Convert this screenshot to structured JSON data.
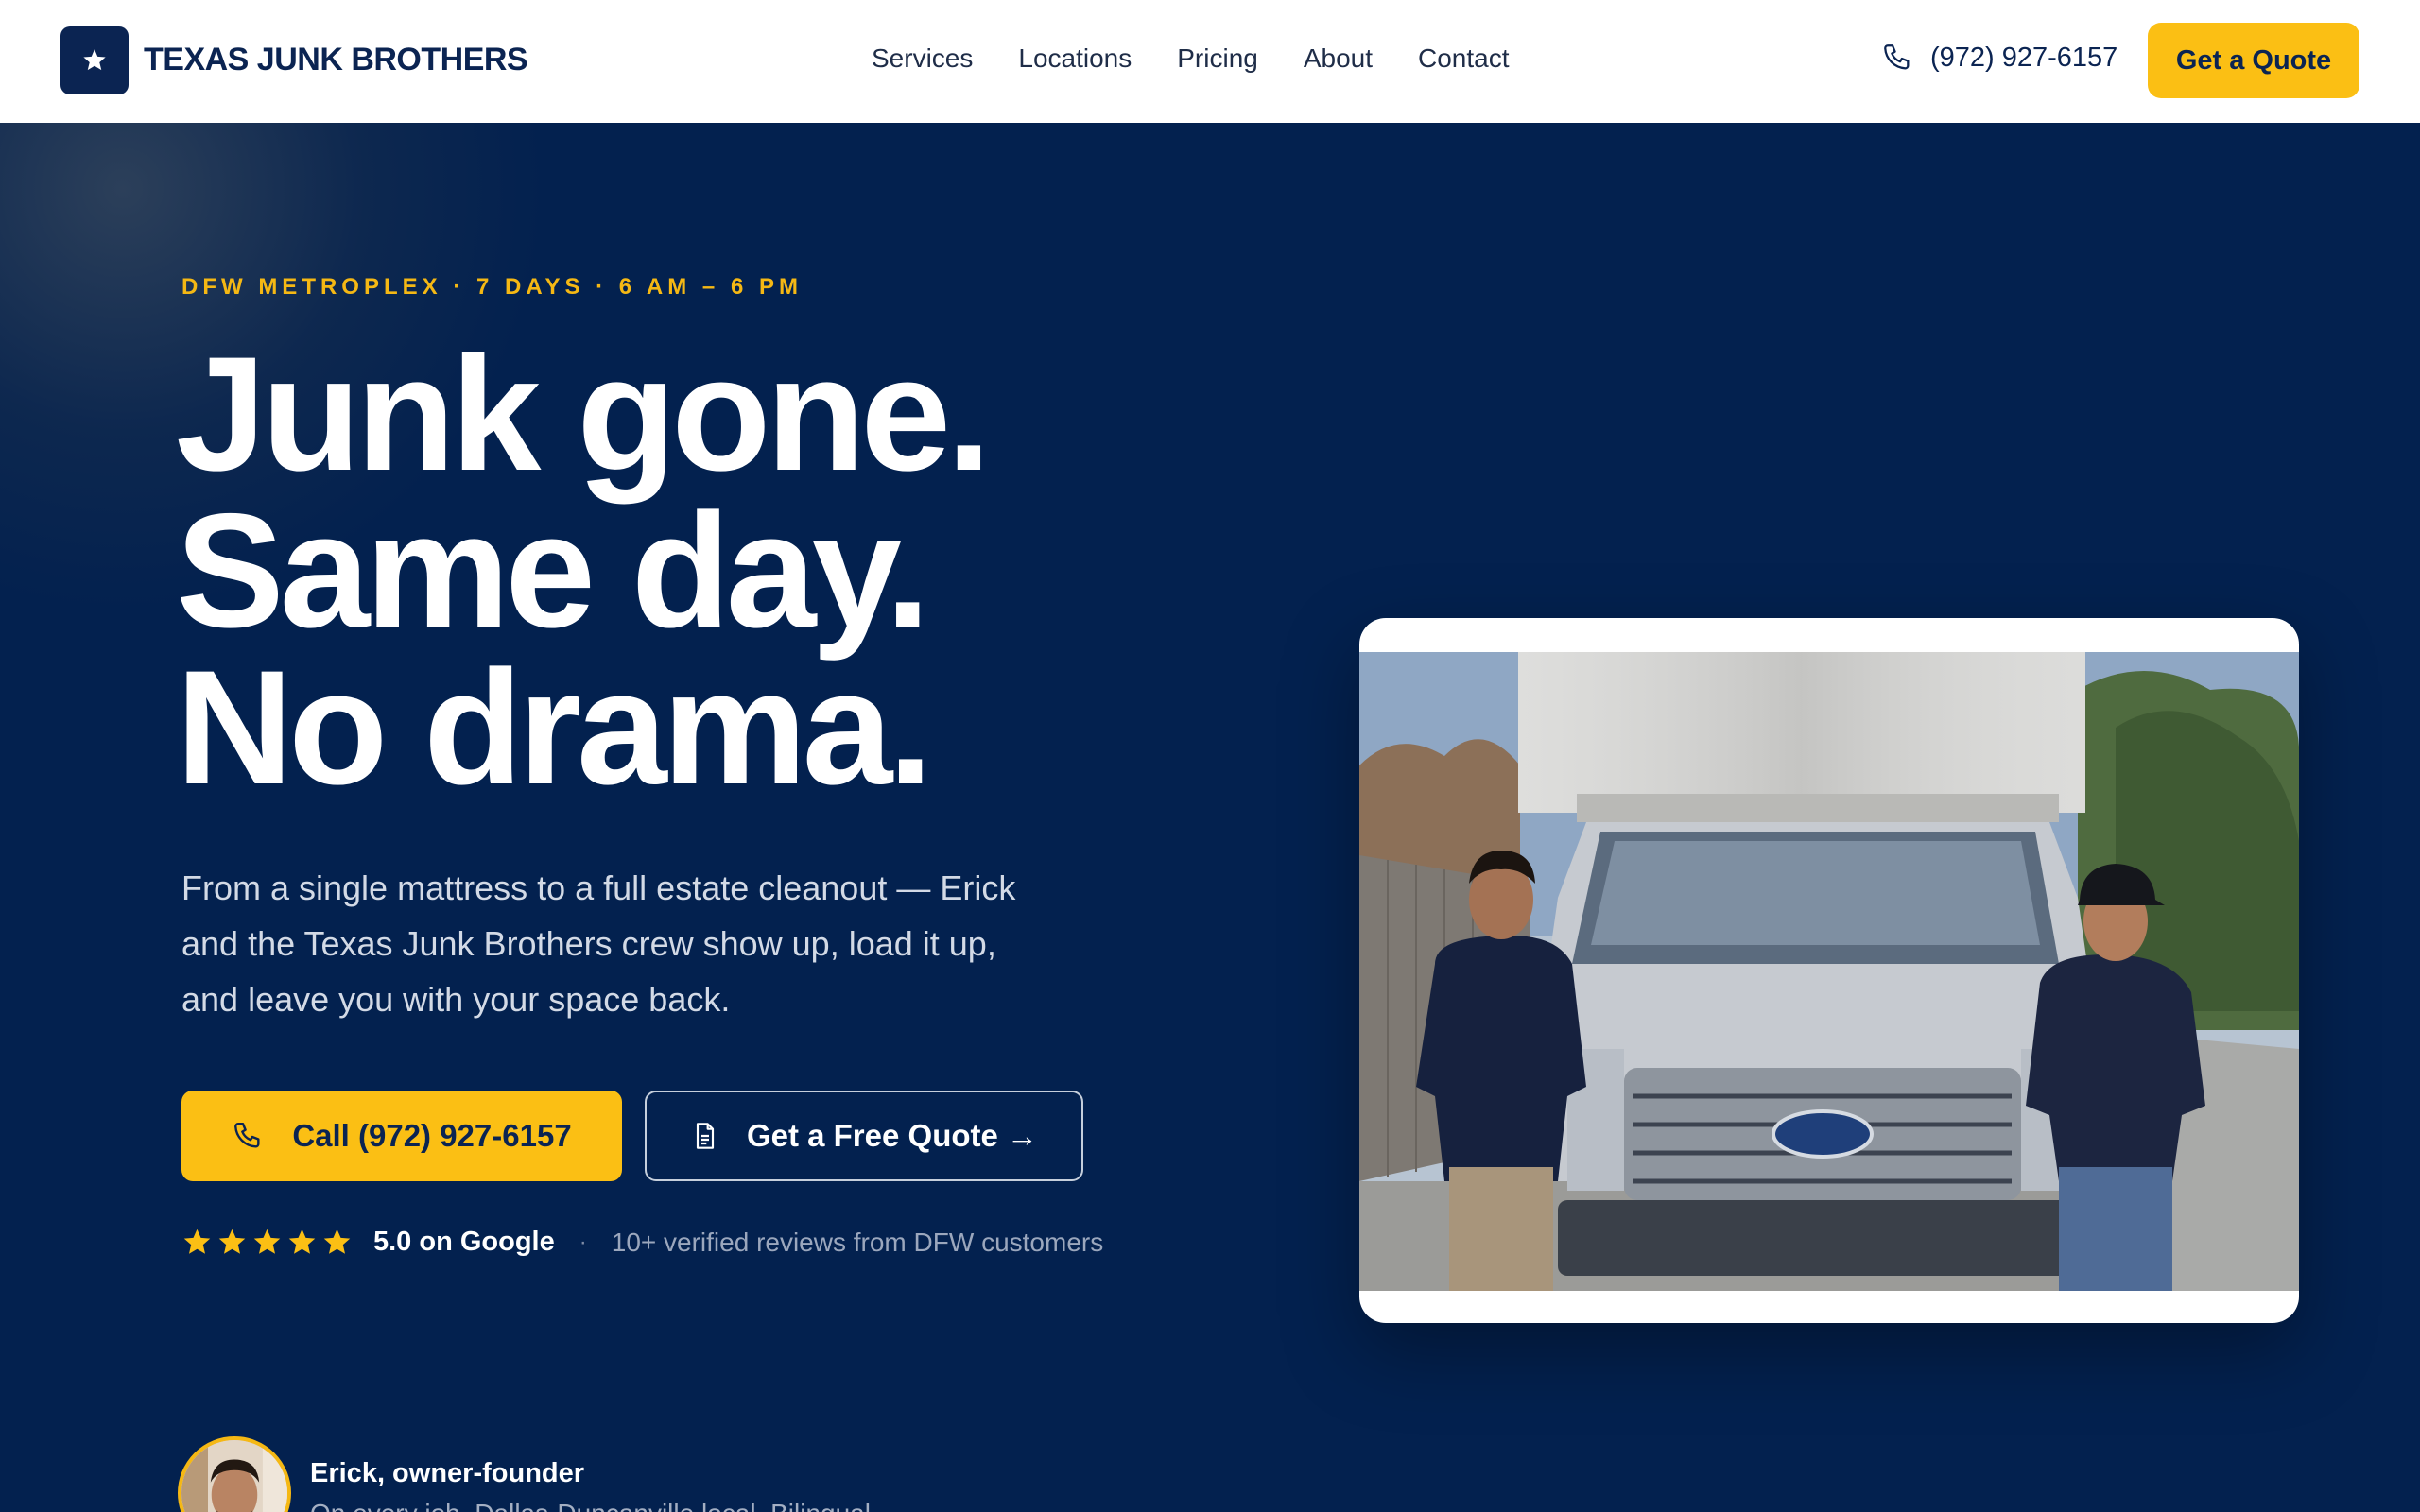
{
  "header": {
    "brand": "TEXAS JUNK BROTHERS",
    "logo_icon": "star-icon",
    "nav": [
      "Services",
      "Locations",
      "Pricing",
      "About",
      "Contact"
    ],
    "phone": "(972) 927-6157",
    "cta": "Get a Quote"
  },
  "hero": {
    "eyebrow": "DFW METROPLEX · 7 DAYS · 6 AM – 6 PM",
    "headline": [
      "Junk gone.",
      "Same day.",
      "No drama."
    ],
    "lede": "From a single mattress to a full estate cleanout — Erick and the Texas Junk Brothers crew show up, load it up, and leave you with your space back.",
    "call_button": "Call (972) 927-6157",
    "quote_button": "Get a Free Quote →",
    "rating": {
      "stars": 5,
      "score": "5.0 on Google",
      "separator": "·",
      "note": "10+ verified reviews from DFW customers"
    },
    "owner": {
      "name": "Erick, owner-founder",
      "subtitle": "On every job. Dallas-Duncanville local. Bilingual."
    }
  },
  "colors": {
    "navy": "#03214f",
    "accent_yellow": "#fbbf14",
    "white": "#ffffff"
  }
}
